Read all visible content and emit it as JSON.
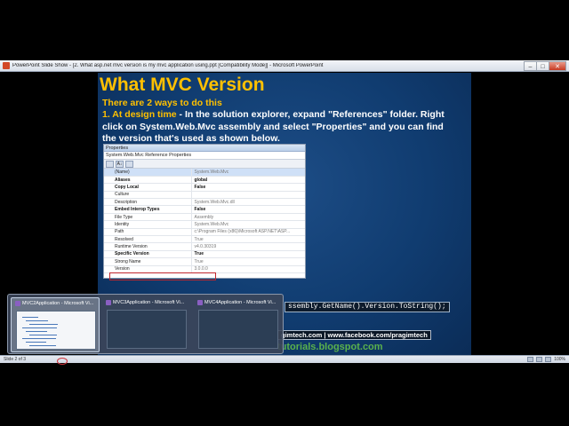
{
  "window": {
    "title": "PowerPoint Slide Show - [2. What asp.net mvc version is my mvc application using.ppt [Compatibility Mode]] - Microsoft PowerPoint",
    "buttons": {
      "minimize": "–",
      "maximize": "□",
      "close": "✕"
    }
  },
  "slide": {
    "title": "What MVC Version",
    "subhead": "There are 2 ways to do this",
    "point_label": "1. At design time",
    "point_text": " - In the solution explorer, expand \"References\" folder. Right click on System.Web.Mvc assembly and select \"Properties\" and you can find the version that's used as shown below.",
    "code_snippet": "ssembly.GetName().Version.ToString();",
    "contact": "gimtech.com | www.facebook.com/pragimtech",
    "blog": "tutorials.blogspot.com"
  },
  "properties_panel": {
    "header": "Properties",
    "object": "System.Web.Mvc  Reference Properties",
    "tool_sort": "A↓",
    "rows": [
      {
        "name": "(Name)",
        "value": "System.Web.Mvc",
        "bold": false,
        "selected": true
      },
      {
        "name": "Aliases",
        "value": "global",
        "bold": true
      },
      {
        "name": "Copy Local",
        "value": "False",
        "bold": true
      },
      {
        "name": "Culture",
        "value": "",
        "bold": false
      },
      {
        "name": "Description",
        "value": "System.Web.Mvc.dll",
        "bold": false
      },
      {
        "name": "Embed Interop Types",
        "value": "False",
        "bold": true
      },
      {
        "name": "File Type",
        "value": "Assembly",
        "bold": false
      },
      {
        "name": "Identity",
        "value": "System.Web.Mvc",
        "bold": false
      },
      {
        "name": "Path",
        "value": "c:\\Program Files (x86)\\Microsoft ASP.NET\\ASP...",
        "bold": false
      },
      {
        "name": "Resolved",
        "value": "True",
        "bold": false
      },
      {
        "name": "Runtime Version",
        "value": "v4.0.30319",
        "bold": false
      },
      {
        "name": "Specific Version",
        "value": "True",
        "bold": true
      },
      {
        "name": "Strong Name",
        "value": "True",
        "bold": false
      },
      {
        "name": "Version",
        "value": "3.0.0.0",
        "bold": false
      }
    ]
  },
  "taskbar_thumbnails": [
    {
      "label": "MVC2Application - Microsoft Vi...",
      "active": true
    },
    {
      "label": "MVC3Application - Microsoft Vi...",
      "active": false
    },
    {
      "label": "MVC4Application - Microsoft Vi...",
      "active": false
    }
  ],
  "statusbar": {
    "left": "Slide 2 of 3",
    "zoom": "100%"
  },
  "colors": {
    "accent": "#ffc000",
    "slide_bg": "#103c70",
    "link_green": "#5ab14c",
    "highlight_box": "#c0272d"
  }
}
